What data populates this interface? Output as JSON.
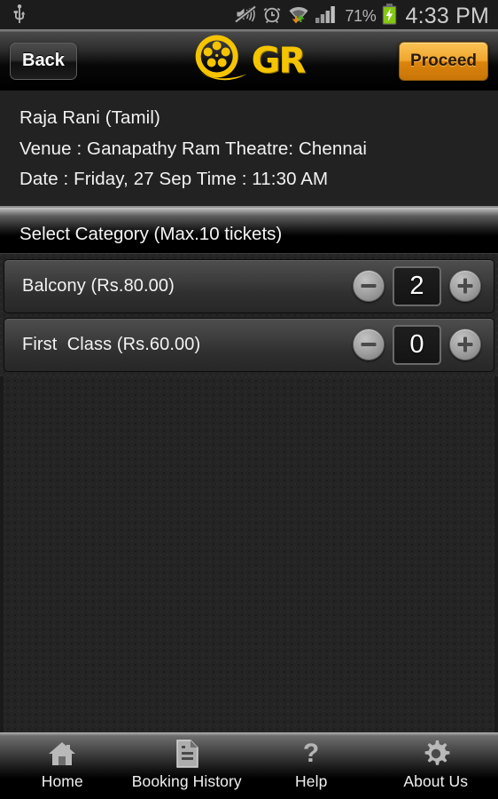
{
  "statusbar": {
    "usb_icon": "usb-icon",
    "mute_icon": "volume-mute-icon",
    "alarm_icon": "alarm-clock-icon",
    "wifi_icon": "wifi-data-transfer-icon",
    "signal_icon": "cellular-signal-icon",
    "battery_percent": "71%",
    "battery_icon": "battery-charging-icon",
    "time": "4:33 PM"
  },
  "actionbar": {
    "back_label": "Back",
    "proceed_label": "Proceed",
    "logo_icon": "film-reel-icon",
    "logo_text": "GR",
    "logo_color": "#f5c400",
    "proceed_color": "#f0a62c"
  },
  "event": {
    "title": "Raja Rani (Tamil)",
    "venue": "Venue : Ganapathy Ram Theatre: Chennai",
    "datetime": "Date : Friday, 27 Sep  Time : 11:30 AM"
  },
  "section": {
    "header": "Select Category (Max.10 tickets)"
  },
  "categories": [
    {
      "label": "Balcony (Rs.80.00)",
      "value": "2",
      "minus_icon": "minus-circle-icon",
      "plus_icon": "plus-circle-icon"
    },
    {
      "label": "First  Class (Rs.60.00)",
      "value": "0",
      "minus_icon": "minus-circle-icon",
      "plus_icon": "plus-circle-icon"
    }
  ],
  "bottomnav": [
    {
      "label": "Home",
      "icon": "home-icon"
    },
    {
      "label": "Booking History",
      "icon": "document-icon"
    },
    {
      "label": "Help",
      "icon": "question-mark-icon"
    },
    {
      "label": "About Us",
      "icon": "gear-icon"
    }
  ]
}
